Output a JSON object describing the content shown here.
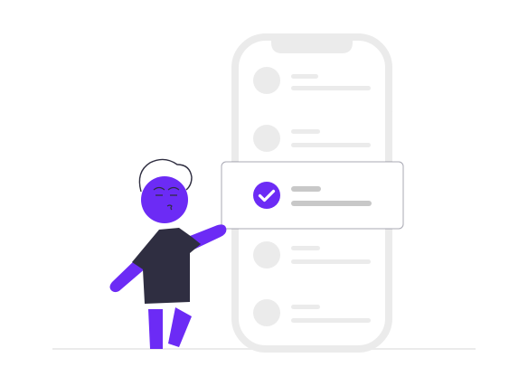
{
  "illustration": {
    "description_hidden": "",
    "colors": {
      "accent": "#6c2bf5",
      "phone_frame": "#ebebeb",
      "placeholder_light": "#ebebeb",
      "placeholder_mid": "#c8c8c8",
      "card_border": "#3f3d56",
      "shirt": "#2f2e41",
      "ground": "#ebebeb",
      "hair_outline": "#2f2e41",
      "check": "#ffffff"
    },
    "icons": {
      "selected_item": "checkmark-icon"
    },
    "list": {
      "rows": 5,
      "selected_index": 2
    }
  }
}
